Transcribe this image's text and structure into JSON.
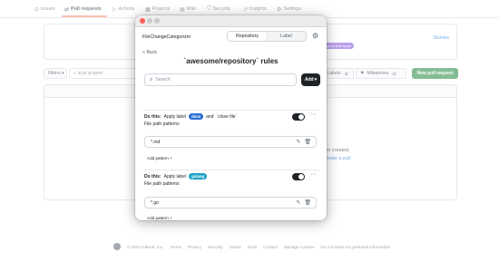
{
  "repo_nav": {
    "items": [
      {
        "icon": "issue-icon",
        "glyph": "⊙",
        "label": "Issues"
      },
      {
        "icon": "pull-request-icon",
        "glyph": "⇄",
        "label": "Pull requests"
      },
      {
        "icon": "actions-icon",
        "glyph": "▷",
        "label": "Actions"
      },
      {
        "icon": "projects-icon",
        "glyph": "▦",
        "label": "Projects"
      },
      {
        "icon": "wiki-icon",
        "glyph": "▤",
        "label": "Wiki"
      },
      {
        "icon": "security-icon",
        "glyph": "⛉",
        "label": "Security"
      },
      {
        "icon": "insights-icon",
        "glyph": "↗",
        "label": "Insights"
      },
      {
        "icon": "settings-icon",
        "glyph": "⚙",
        "label": "Settings"
      }
    ]
  },
  "background": {
    "banner_dismiss": "Dismiss",
    "banner_badge": "good first issue",
    "filters_label": "Filters",
    "filters_search": "is:pr is:open",
    "labels_label": "Labels",
    "labels_count": "9",
    "milestones_label": "Milestones",
    "milestones_count": "0",
    "new_pr_label": "New pull request",
    "empty_text": "s are created.",
    "empty_link_prefix": "d ",
    "empty_link": "create a pull"
  },
  "footer": {
    "copyright": "© 2024 GitHub, Inc.",
    "links": [
      "Terms",
      "Privacy",
      "Security",
      "Status",
      "Docs",
      "Contact",
      "Manage cookies",
      "Do not share my personal information"
    ]
  },
  "popup": {
    "extension_name": "FileChangeCategorizer",
    "tabs": [
      "Repository",
      "Label"
    ],
    "active_tab": "Repository",
    "back_label": "< Back",
    "title": "`awesome/repository` rules",
    "search_placeholder": "Search",
    "add_button": "Add",
    "rules": [
      {
        "do_this": "Do this:",
        "action": "Apply label",
        "label": "docs",
        "label_color": "#2b6fd6",
        "extra_and": "and",
        "extra_action": "`close file`",
        "patterns_heading": "File path patterns",
        "pattern": "*.md",
        "add_pattern": "Add pattern +",
        "enabled": true
      },
      {
        "do_this": "Do this:",
        "action": "Apply label",
        "label": "golang",
        "label_color": "#1ca0c8",
        "patterns_heading": "File path patterns",
        "pattern": "*.go",
        "add_pattern": "Add pattern +",
        "enabled": true
      }
    ]
  }
}
